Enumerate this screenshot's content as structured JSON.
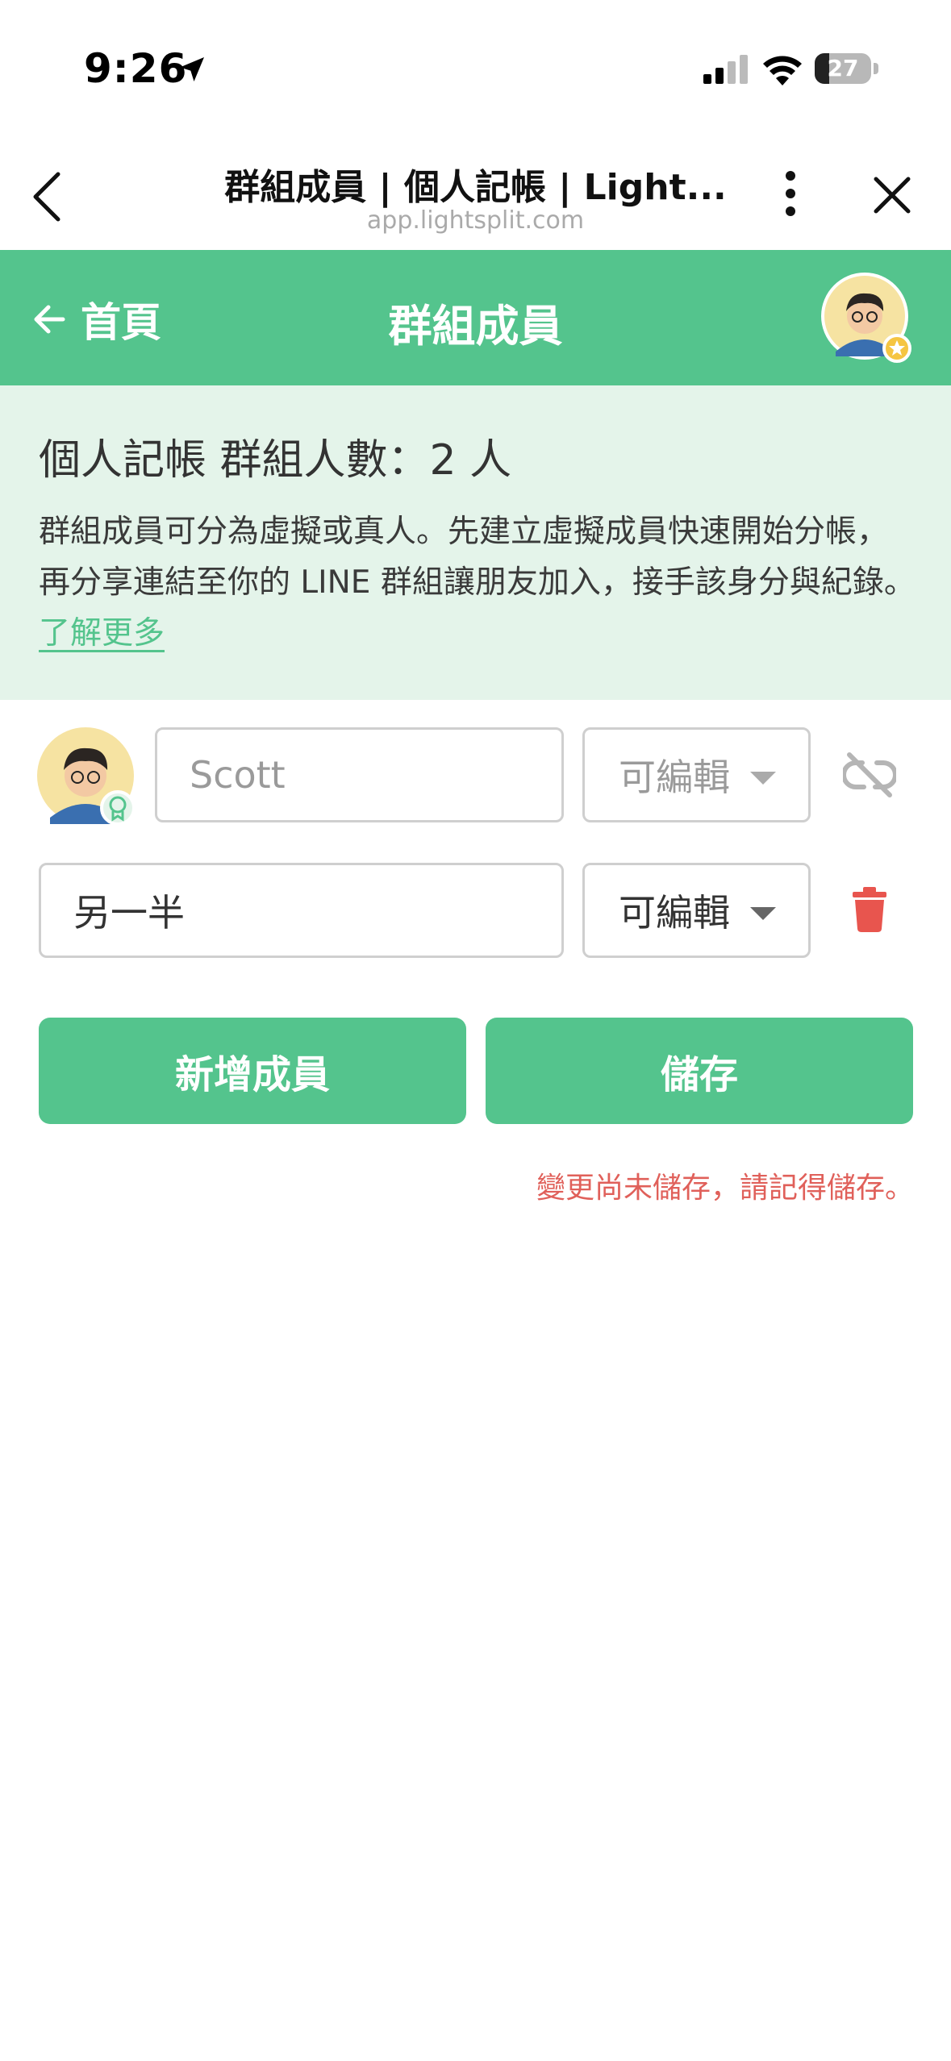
{
  "status": {
    "time": "9:26",
    "battery": "27"
  },
  "browser": {
    "title": "群組成員 | 個人記帳 | Light...",
    "url": "app.lightsplit.com"
  },
  "header": {
    "home_label": "首頁",
    "title": "群組成員"
  },
  "info": {
    "title": "個人記帳 群組人數：2 人",
    "description": "群組成員可分為虛擬或真人。先建立虛擬成員快速開始分帳，再分享連結至你的 LINE 群組讓朋友加入，接手該身分與紀錄。",
    "learn_more": "了解更多"
  },
  "members": [
    {
      "name": "",
      "placeholder": "Scott",
      "permission": "可編輯",
      "action_icon": "unlink-icon"
    },
    {
      "name": "另一半",
      "placeholder": "",
      "permission": "可編輯",
      "action_icon": "trash-icon"
    }
  ],
  "buttons": {
    "add_member": "新增成員",
    "save": "儲存"
  },
  "unsaved_note": "變更尚未儲存，請記得儲存。",
  "colors": {
    "primary": "#54c48d",
    "banner_bg": "#e4f4ea",
    "danger": "#e8554e",
    "warning_text": "#e0605a"
  }
}
